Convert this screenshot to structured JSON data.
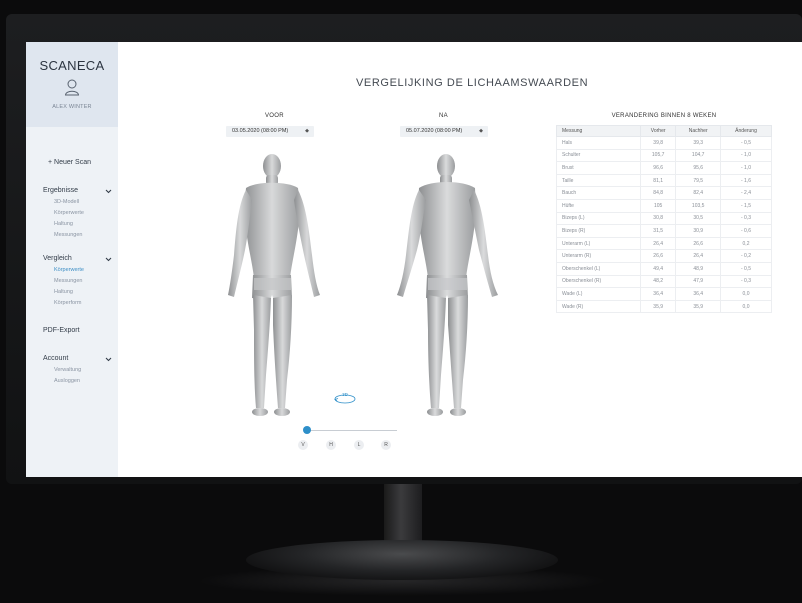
{
  "sidebar": {
    "logo": "SCANECA",
    "user_name": "ALEX WINTER",
    "new_scan": "+ Neuer Scan",
    "groups": [
      {
        "label": "Ergebnisse",
        "items": [
          "3D-Modell",
          "Körperwerte",
          "Haltung",
          "Messungen"
        ]
      },
      {
        "label": "Vergleich",
        "items": [
          "Körperwerte",
          "Messungen",
          "Haltung",
          "Körperform"
        ],
        "active_item": "Körperwerte"
      },
      {
        "label": "PDF-Export",
        "items": []
      },
      {
        "label": "Account",
        "items": [
          "Verwaltung",
          "Ausloggen"
        ]
      }
    ]
  },
  "main": {
    "title": "VERGELIJKING DE LICHAAMSWAARDEN",
    "before": {
      "label": "VOOR",
      "date": "03.05.2020 (08:00 PM)"
    },
    "after": {
      "label": "NA",
      "date": "05.07.2020 (08:00 PM)"
    },
    "rotate_label": "3D",
    "view_buttons": [
      "V",
      "H",
      "L",
      "R"
    ],
    "slider_value": 0
  },
  "table": {
    "title": "VERANDERING BINNEN 8 WEKEN",
    "headers": [
      "Messung",
      "Vorher",
      "Nachher",
      "Änderung"
    ],
    "rows": [
      [
        "Hals",
        "39,8",
        "39,3",
        "- 0,5"
      ],
      [
        "Schulter",
        "105,7",
        "104,7",
        "- 1,0"
      ],
      [
        "Brust",
        "96,6",
        "95,6",
        "- 1,0"
      ],
      [
        "Taille",
        "81,1",
        "79,5",
        "- 1,6"
      ],
      [
        "Bauch",
        "84,8",
        "82,4",
        "- 2,4"
      ],
      [
        "Hüfte",
        "105",
        "103,5",
        "- 1,5"
      ],
      [
        "Bizeps (L)",
        "30,8",
        "30,5",
        "- 0,3"
      ],
      [
        "Bizeps (R)",
        "31,5",
        "30,9",
        "- 0,6"
      ],
      [
        "Unterarm (L)",
        "26,4",
        "26,6",
        "0,2"
      ],
      [
        "Unterarm (R)",
        "26,6",
        "26,4",
        "- 0,2"
      ],
      [
        "Oberschenkel (L)",
        "49,4",
        "48,9",
        "- 0,5"
      ],
      [
        "Oberschenkel (R)",
        "48,2",
        "47,9",
        "- 0,3"
      ],
      [
        "Wade (L)",
        "36,4",
        "36,4",
        "0,0"
      ],
      [
        "Wade (R)",
        "35,9",
        "35,9",
        "0,0"
      ]
    ]
  },
  "colors": {
    "accent": "#2e8fc9",
    "sidebar_bg": "#eef2f6",
    "sidebar_header_bg": "#dfe6ef",
    "frame": "#151618"
  }
}
